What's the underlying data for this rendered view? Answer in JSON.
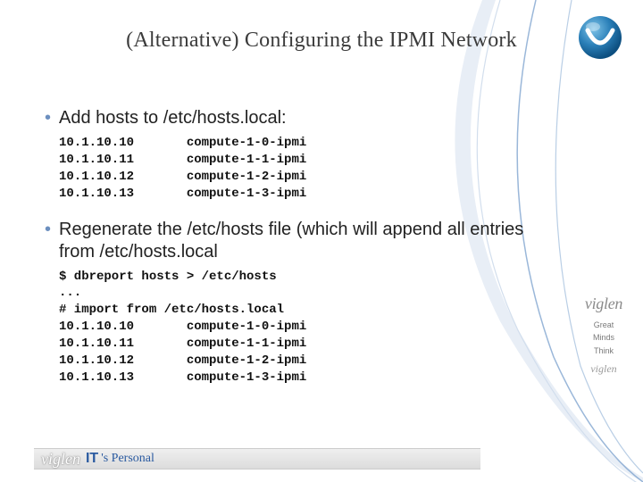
{
  "title": "(Alternative) Configuring the IPMI Network",
  "bullets": {
    "b1": "Add hosts to /etc/hosts.local:",
    "b2": "Regenerate the /etc/hosts file (which will append all entries from /etc/hosts.local"
  },
  "code1": "10.1.10.10       compute-1-0-ipmi\n10.1.10.11       compute-1-1-ipmi\n10.1.10.12       compute-1-2-ipmi\n10.1.10.13       compute-1-3-ipmi",
  "code2": "$ dbreport hosts > /etc/hosts\n...\n# import from /etc/hosts.local\n10.1.10.10       compute-1-0-ipmi\n10.1.10.11       compute-1-1-ipmi\n10.1.10.12       compute-1-2-ipmi\n10.1.10.13       compute-1-3-ipmi",
  "brand": {
    "name": "viglen",
    "tag1": "Great",
    "tag2": "Minds",
    "tag3": "Think",
    "mini": "viglen"
  },
  "footer": {
    "brand": "viglen",
    "it": "IT",
    "slogan": "'s Personal"
  }
}
